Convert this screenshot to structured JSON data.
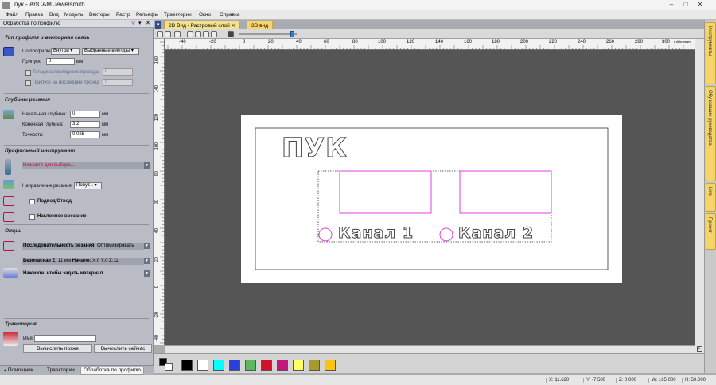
{
  "window": {
    "title": "пук - ArtCAM Jewelsmith"
  },
  "menu": [
    "Файл",
    "Правка",
    "Вид",
    "Модель",
    "Векторы",
    "Растр",
    "Рельефы",
    "Траектории",
    "Окно",
    "Справка"
  ],
  "panel": {
    "header": "Обработка по профилю",
    "sec_profile": "Тип профиля и векторная связь",
    "profile_label": "По профилю",
    "profile_side": "Внутри",
    "profile_vectors": "Выбранные векторы",
    "allowance_label": "Припуск:",
    "allowance_value": "0",
    "allowance_unit": "мм",
    "last_pass_thickness": "Толщина последнего прохода",
    "last_pass_thickness_value": "0",
    "last_pass_allowance": "Припуск на последний проход",
    "last_pass_allowance_value": "0",
    "sec_depth": "Глубины резания",
    "start_depth_label": "Начальная глубина:",
    "start_depth_value": "0",
    "end_depth_label": "Конечная глубина:",
    "end_depth_value": "3.2",
    "tolerance_label": "Точность:",
    "tolerance_value": "0.025",
    "unit_mm": "мм",
    "sec_tool": "Профильный инструмент",
    "tool_select": "Нажмите для выбора...",
    "cut_direction_label": "Направление резания:",
    "cut_direction_value": "Попут...",
    "lead_label": "Подвод/Отвод",
    "ramp_label": "Наклонное врезание",
    "sec_options": "Опции",
    "order_label": "Последовательность резания:",
    "order_value": "Оптимизировать",
    "safe_z_label": "Безопасная Z:",
    "safe_z_value": "11 мм",
    "start_label": "Начало:",
    "start_value": "X:0 Y:0 Z:11",
    "material_label": "Нажмите, чтобы задать материал...",
    "sec_toolpath": "Траектория",
    "name_label": "Имя:",
    "name_value": "",
    "calc_later": "Вычислить позже",
    "calc_now": "Вычислить сейчас"
  },
  "bottom_tabs": [
    "Помощник",
    "Траектории",
    "Обработка по профилю"
  ],
  "doc_tabs": [
    "2D Вид - Растровый слой",
    "3D вид"
  ],
  "ruler": {
    "top": [
      "-40",
      "-20",
      "0",
      "20",
      "40",
      "60",
      "80",
      "100",
      "120",
      "140",
      "160",
      "180",
      "200",
      "220",
      "240",
      "260",
      "280",
      "300"
    ],
    "top_unit": "millimetres",
    "left": [
      "160",
      "140",
      "120",
      "100",
      "80",
      "60",
      "40",
      "20",
      "0",
      "-20",
      "-40"
    ]
  },
  "drawing": {
    "title_text": "ПУК",
    "channel1": "Канал 1",
    "channel2": "Канал 2",
    "accent": "#e040e0"
  },
  "right_tabs": [
    "Инструменты",
    "Обучающие руководства",
    "Live",
    "Проект"
  ],
  "palette": [
    "#000000",
    "#ffffff",
    "#00ffff",
    "#2c3fd6",
    "#5cb85c",
    "#d0112b",
    "#c2187d",
    "#ffff66",
    "#a79a2c",
    "#ffc20e"
  ],
  "status": {
    "x": "X: 11.620",
    "y": "Y: -7.500",
    "z": "Z: 0.000",
    "w": "W: 165.000",
    "h": "H: 50.000"
  }
}
